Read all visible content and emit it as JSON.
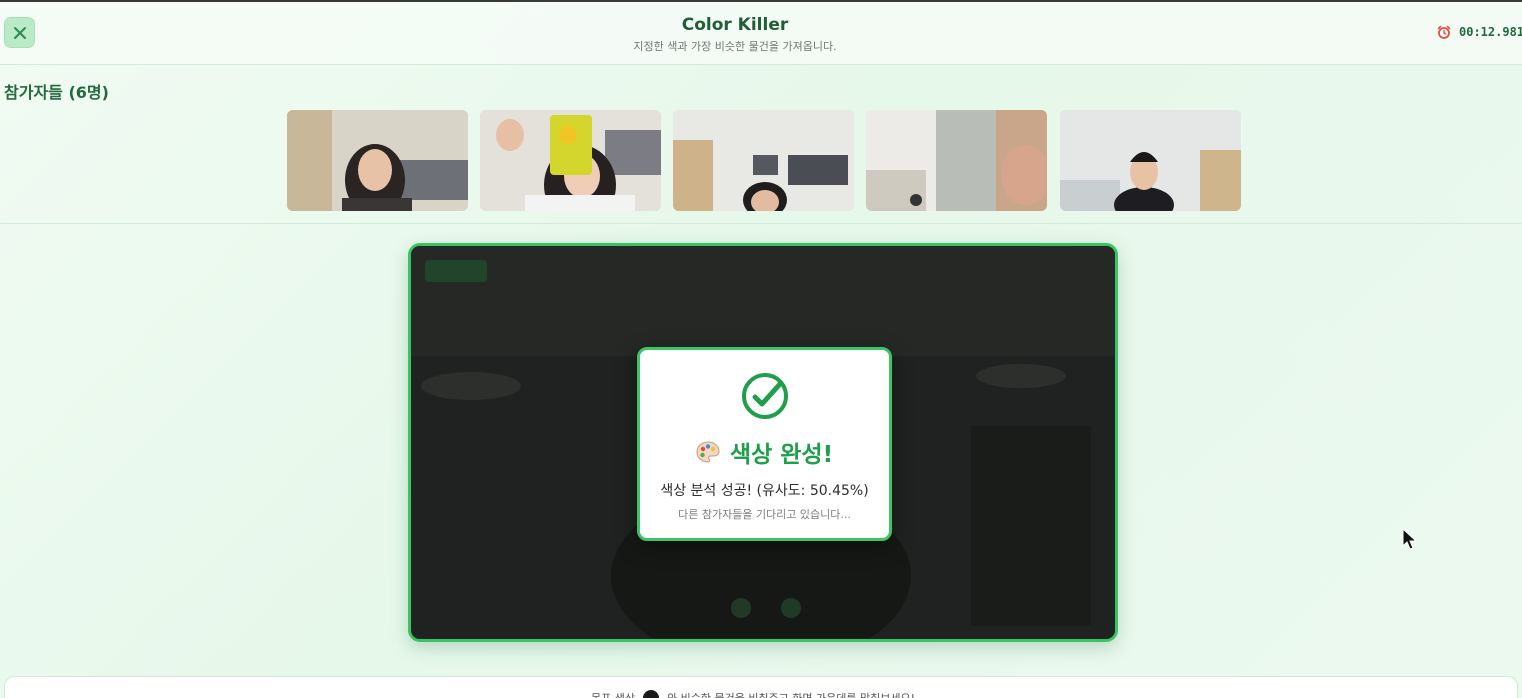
{
  "header": {
    "title": "Color Killer",
    "subtitle": "지정한 색과 가장 비슷한 물건을 가져옵니다.",
    "timer": "00:12.981",
    "icons": {
      "close": "close-icon",
      "timer": "alarm-clock-icon"
    }
  },
  "participants": {
    "title": "참가자들 (6명)",
    "thumbnails": [
      {
        "label": "participant-1"
      },
      {
        "label": "participant-2"
      },
      {
        "label": "participant-3"
      },
      {
        "label": "participant-4"
      },
      {
        "label": "participant-5"
      }
    ]
  },
  "modal": {
    "title": "색상 완성!",
    "message": "색상 분석 성공! (유사도: 50.45%)",
    "sub": "다른 참가자들을 기다리고 있습니다...",
    "similarity_percent": 50.45,
    "icons": {
      "check": "check-circle-icon",
      "palette": "palette-icon"
    }
  },
  "bottom": {
    "label": "목표 색상",
    "hint": "와 비슷한 물건을 비춰주고 화면 가운데를 맞춰보세요!"
  },
  "colors": {
    "accent": "#39c463",
    "title_green": "#1f5e36",
    "success_green": "#1f9e4b",
    "target_color": "#1a1a1a"
  }
}
